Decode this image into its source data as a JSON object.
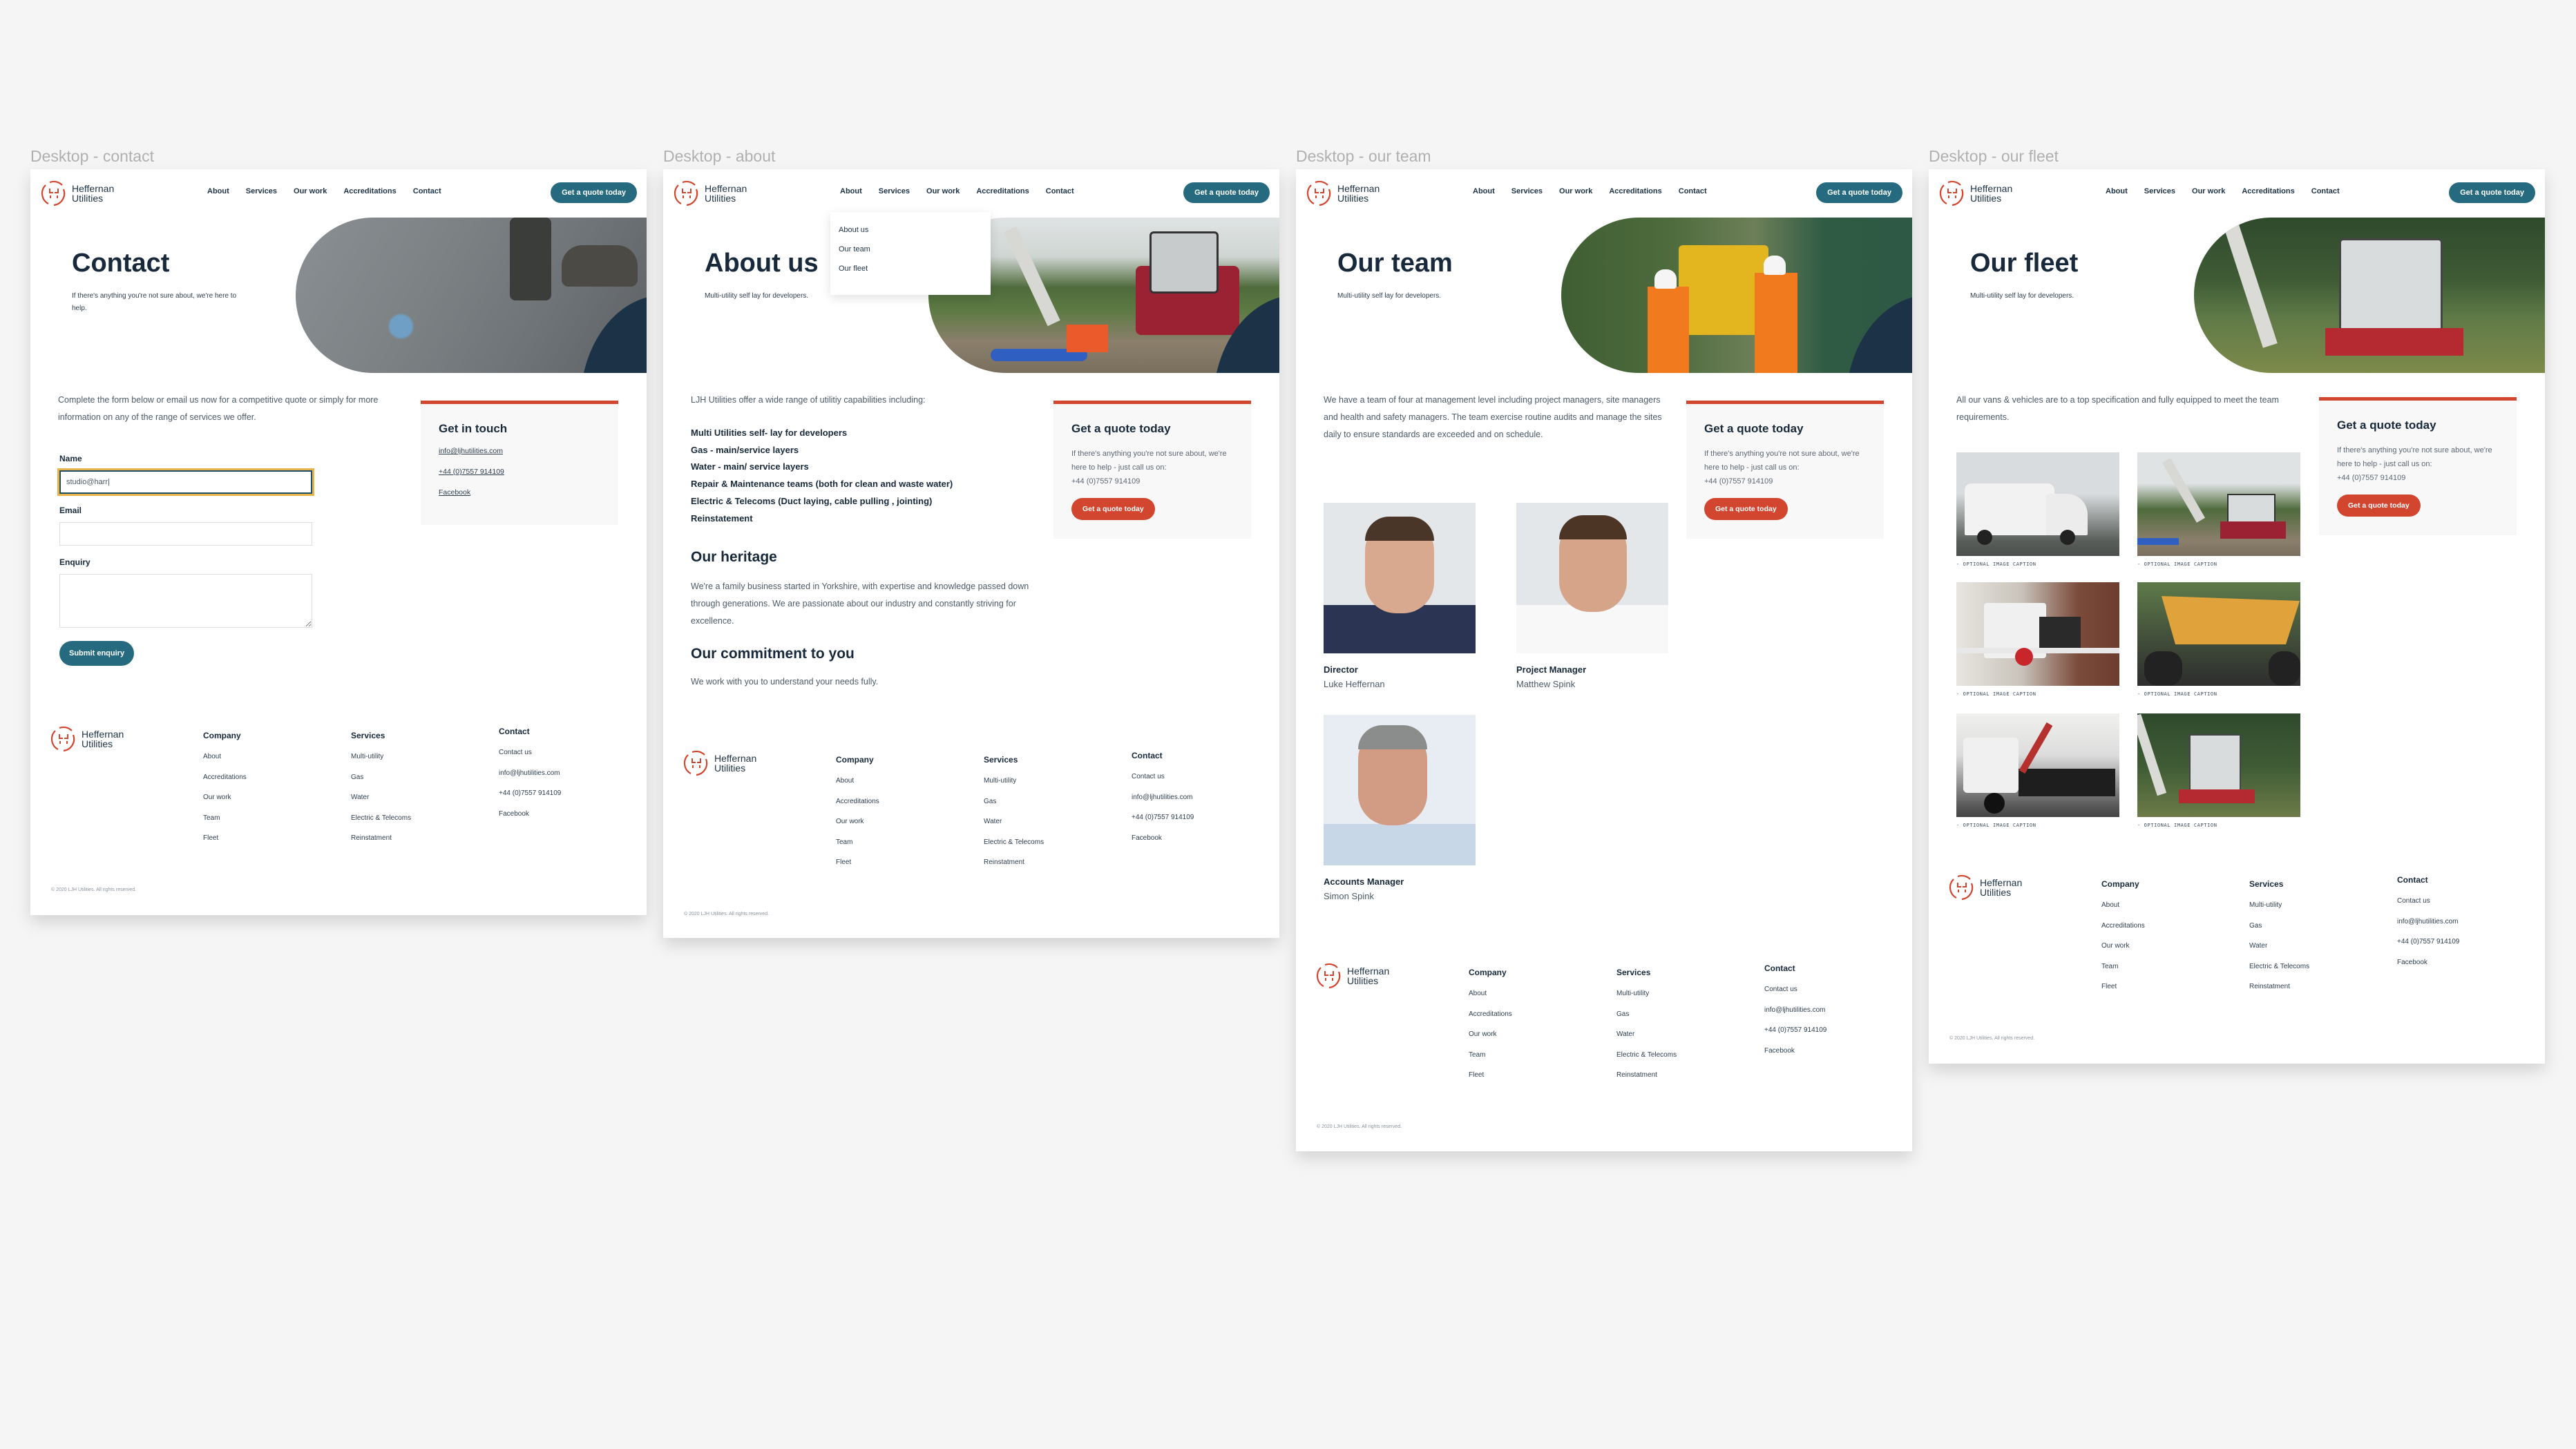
{
  "brand": {
    "name_line1": "Heffernan",
    "name_line2": "Utilities",
    "colors": {
      "navy": "#17293a",
      "teal": "#266a80",
      "red": "#d2452f",
      "dark_panel": "#1c3347"
    }
  },
  "nav": {
    "items": [
      "About",
      "Services",
      "Our work",
      "Accreditations",
      "Contact"
    ],
    "cta_label": "Get a quote today"
  },
  "sidebar_quote": {
    "title": "Get a quote today",
    "text": "If there's anything you're not sure about, we're here to help - just call us on:",
    "phone": "+44 (0)7557 914109",
    "button_label": "Get a quote today"
  },
  "footer": {
    "company_title": "Company",
    "company_links": [
      "About",
      "Accreditations",
      "Our work",
      "Team",
      "Fleet"
    ],
    "services_title": "Services",
    "services_links": [
      "Multi-utility",
      "Gas",
      "Water",
      "Electric & Telecoms",
      "Reinstatment"
    ],
    "contact_title": "Contact",
    "contact_links": [
      "Contact us",
      "info@ljhutilities.com",
      "+44 (0)7557 914109",
      "Facebook"
    ],
    "copyright": "© 2020 LJH Utilities. All rights reserved."
  },
  "pages": {
    "contact": {
      "frame_label": "Desktop - contact",
      "title": "Contact",
      "subtitle": "If there's anything you're not sure about, we're here to help.",
      "intro": "Complete the form below or email us now for a competitive quote or simply for more information on any of the range of services we offer.",
      "form": {
        "name_label": "Name",
        "name_value": "studio@harr|",
        "email_label": "Email",
        "email_value": "",
        "enquiry_label": "Enquiry",
        "enquiry_value": "",
        "submit_label": "Submit enquiry"
      },
      "get_in_touch": {
        "title": "Get in touch",
        "email": "info@ljhutilities.com",
        "phone": "+44 (0)7557 914109",
        "facebook": "Facebook"
      }
    },
    "about": {
      "frame_label": "Desktop - about",
      "title": "About us",
      "subtitle": "Multi-utility self lay for developers.",
      "dropdown": [
        "About us",
        "Our team",
        "Our fleet"
      ],
      "intro": "LJH Utilities offer a wide range of utilitiy capabilities including:",
      "capabilities": [
        "Multi Utilities self- lay for developers",
        "Gas - main/service layers",
        "Water - main/ service layers",
        "Repair & Maintenance teams (both for clean and waste water)",
        "Electric & Telecoms  (Duct laying, cable pulling , jointing)",
        "Reinstatement"
      ],
      "heritage_title": "Our heritage",
      "heritage_text": "We're a family business started in Yorkshire, with expertise and knowledge passed down through generations. We are passionate about our industry and constantly striving for excellence.",
      "commitment_title": "Our commitment to you",
      "commitment_text": "We work with you to understand your needs fully."
    },
    "team": {
      "frame_label": "Desktop - our team",
      "title": "Our team",
      "subtitle": "Multi-utility self lay for developers.",
      "intro": "We have a team of four at management level including project managers, site managers and health and safety managers. The team exercise routine audits and manage the sites daily to ensure standards are exceeded and on schedule.",
      "members": [
        {
          "role": "Director",
          "name": "Luke Heffernan"
        },
        {
          "role": "Project Manager",
          "name": "Matthew Spink"
        },
        {
          "role": "Accounts Manager",
          "name": "Simon Spink"
        }
      ]
    },
    "fleet": {
      "frame_label": "Desktop - our fleet",
      "title": "Our fleet",
      "subtitle": "Multi-utility self lay for developers.",
      "intro": "All our vans & vehicles are to a top specification and fully equipped to meet the team requirements.",
      "images": [
        {
          "subject": "white van",
          "caption": "- OPTIONAL IMAGE CAPTION"
        },
        {
          "subject": "excavator",
          "caption": "- OPTIONAL IMAGE CAPTION"
        },
        {
          "subject": "tipper truck",
          "caption": "- OPTIONAL IMAGE CAPTION"
        },
        {
          "subject": "dumper",
          "caption": "- OPTIONAL IMAGE CAPTION"
        },
        {
          "subject": "grab lorry",
          "caption": "- OPTIONAL IMAGE CAPTION"
        },
        {
          "subject": "excavator behind fence",
          "caption": "- OPTIONAL IMAGE CAPTION"
        }
      ]
    }
  }
}
